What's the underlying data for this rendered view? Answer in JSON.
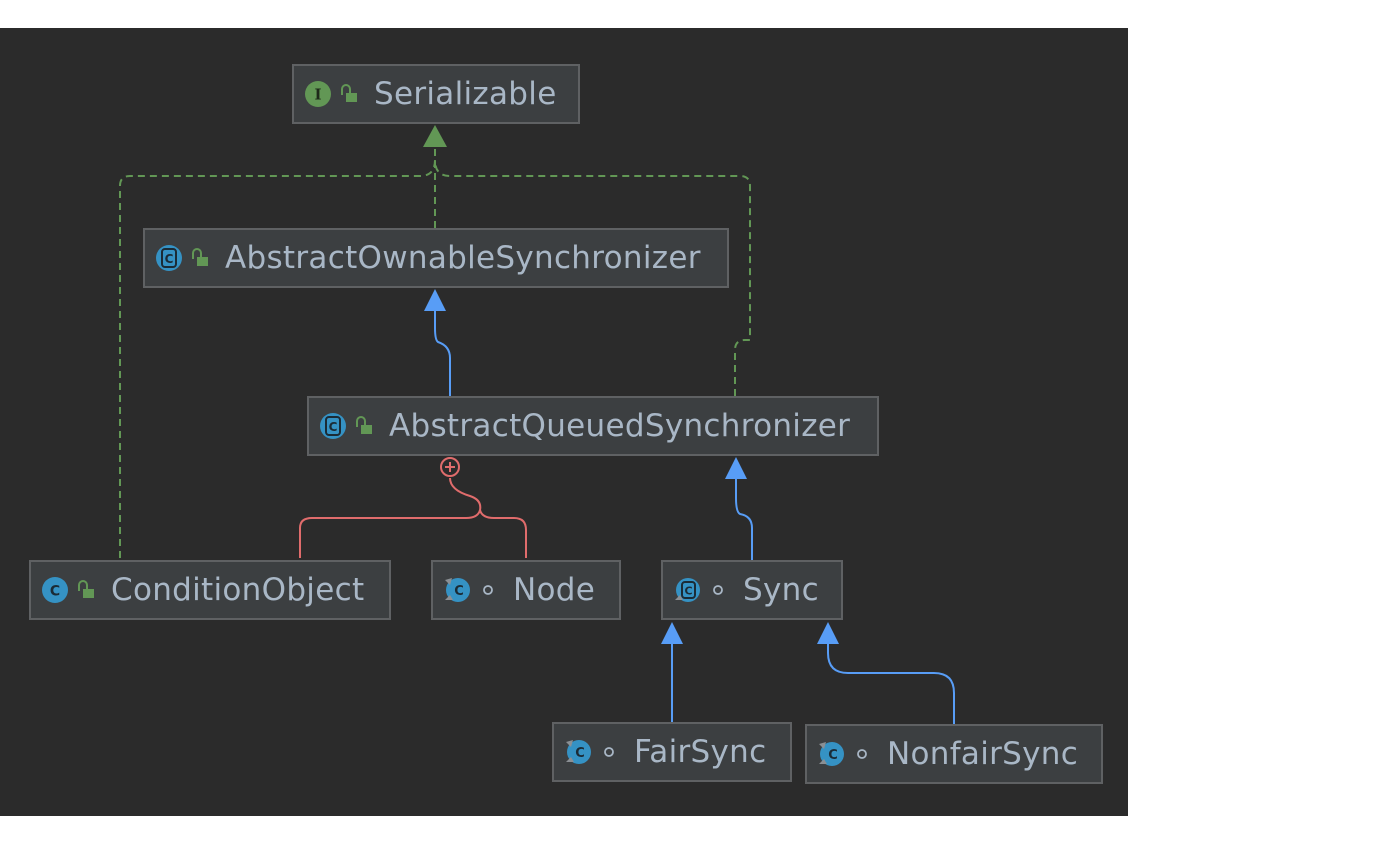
{
  "colors": {
    "background": "#2b2b2b",
    "node_fill": "#3c3f41",
    "node_border": "#5f6163",
    "text": "#a9b7c6",
    "interface_edge": "#629755",
    "extends_edge": "#589df6",
    "inner_edge": "#e06c6c",
    "class_icon": "#3592c4",
    "interface_icon": "#629755"
  },
  "nodes": {
    "serializable": {
      "label": "Serializable",
      "icon": "interface-icon",
      "visibility": "public-icon"
    },
    "aos": {
      "label": "AbstractOwnableSynchronizer",
      "icon": "abstract-class-icon",
      "visibility": "public-icon"
    },
    "aqs": {
      "label": "AbstractQueuedSynchronizer",
      "icon": "abstract-class-icon",
      "visibility": "public-icon"
    },
    "condition": {
      "label": "ConditionObject",
      "icon": "class-icon",
      "visibility": "public-icon"
    },
    "node": {
      "label": "Node",
      "icon": "static-class-icon",
      "visibility": "package-private-icon"
    },
    "sync": {
      "label": "Sync",
      "icon": "static-abstract-class-icon",
      "visibility": "package-private-icon"
    },
    "fairsync": {
      "label": "FairSync",
      "icon": "static-class-icon",
      "visibility": "package-private-icon"
    },
    "nonfairsync": {
      "label": "NonfairSync",
      "icon": "static-class-icon",
      "visibility": "package-private-icon"
    }
  },
  "edges": [
    {
      "from": "aos",
      "to": "serializable",
      "kind": "implements"
    },
    {
      "from": "aqs",
      "to": "serializable",
      "kind": "implements"
    },
    {
      "from": "condition",
      "to": "serializable",
      "kind": "implements"
    },
    {
      "from": "aqs",
      "to": "aos",
      "kind": "extends"
    },
    {
      "from": "sync",
      "to": "aqs",
      "kind": "extends"
    },
    {
      "from": "fairsync",
      "to": "sync",
      "kind": "extends"
    },
    {
      "from": "nonfairsync",
      "to": "sync",
      "kind": "extends"
    },
    {
      "from": "condition",
      "to": "aqs",
      "kind": "inner-class"
    },
    {
      "from": "node",
      "to": "aqs",
      "kind": "inner-class"
    }
  ]
}
